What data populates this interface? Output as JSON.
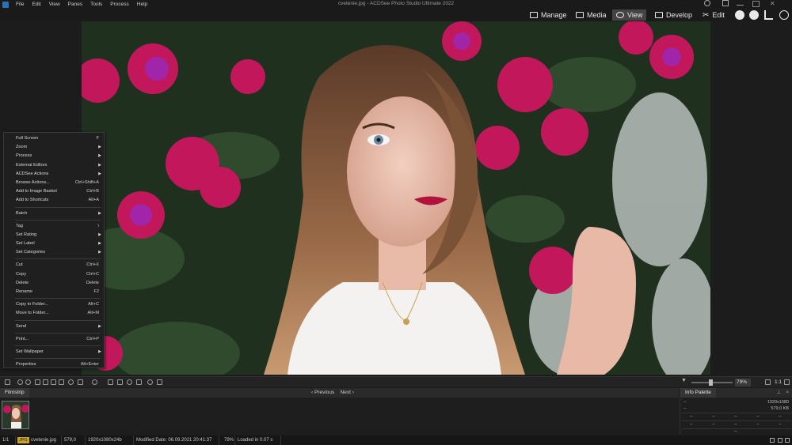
{
  "menubar": {
    "items": [
      "File",
      "Edit",
      "View",
      "Panes",
      "Tools",
      "Process",
      "Help"
    ]
  },
  "window": {
    "title": "cvetenie.jpg - ACDSee Photo Studio Ultimate 2022"
  },
  "modes": [
    {
      "label": "Manage",
      "icon": "manage-icon"
    },
    {
      "label": "Media",
      "icon": "media-icon"
    },
    {
      "label": "View",
      "icon": "eye-icon",
      "active": true
    },
    {
      "label": "Develop",
      "icon": "develop-icon"
    },
    {
      "label": "Edit",
      "icon": "edit-icon"
    }
  ],
  "context_menu": {
    "groups": [
      [
        {
          "label": "Full Screen",
          "shortcut": "F"
        },
        {
          "label": "Zoom",
          "submenu": true
        },
        {
          "label": "Process",
          "submenu": true
        },
        {
          "label": "External Editors",
          "submenu": true
        },
        {
          "label": "ACDSee Actions",
          "submenu": true
        },
        {
          "label": "Browse Actions...",
          "shortcut": "Ctrl+Shift+A"
        },
        {
          "label": "Add to Image Basket",
          "shortcut": "Ctrl+B"
        },
        {
          "label": "Add to Shortcuts",
          "shortcut": "Alt+A"
        }
      ],
      [
        {
          "label": "Batch",
          "submenu": true
        }
      ],
      [
        {
          "label": "Tag",
          "shortcut": "\\"
        },
        {
          "label": "Set Rating",
          "submenu": true
        },
        {
          "label": "Set Label",
          "submenu": true
        },
        {
          "label": "Set Categories",
          "submenu": true
        }
      ],
      [
        {
          "label": "Cut",
          "shortcut": "Ctrl+X"
        },
        {
          "label": "Copy",
          "shortcut": "Ctrl+C"
        },
        {
          "label": "Delete",
          "shortcut": "Delete"
        },
        {
          "label": "Rename",
          "shortcut": "F2"
        }
      ],
      [
        {
          "label": "Copy to Folder...",
          "shortcut": "Alt+C"
        },
        {
          "label": "Move to Folder...",
          "shortcut": "Alt+M"
        }
      ],
      [
        {
          "label": "Send",
          "submenu": true
        }
      ],
      [
        {
          "label": "Print...",
          "shortcut": "Ctrl+P"
        }
      ],
      [
        {
          "label": "Set Wallpaper",
          "submenu": true
        }
      ],
      [
        {
          "label": "Properties",
          "shortcut": "Alt+Enter"
        }
      ]
    ]
  },
  "toolbar": {
    "zoom_value": "79%",
    "ratio_label": "1:1"
  },
  "filmstrip": {
    "tab_label": "Filmstrip",
    "prev_label": "Previous",
    "next_label": "Next"
  },
  "info_palette": {
    "tab_label": "Info Palette",
    "dimensions": "1920x1080",
    "filesize": "579,0 KB",
    "placeholder": "--"
  },
  "statusbar": {
    "counter": "1/1",
    "format": "JPG",
    "filename": "cvetenie.jpg",
    "size": "579,0 KB",
    "dims": "1920x1080x24b jpeg",
    "modified": "Modified Date: 06.09.2021 20:41:37",
    "zoom": "79%",
    "loaded": "Loaded in 0.07 s"
  },
  "colors": {
    "accent_format": "#c9a227",
    "mode_active": "#444444"
  }
}
